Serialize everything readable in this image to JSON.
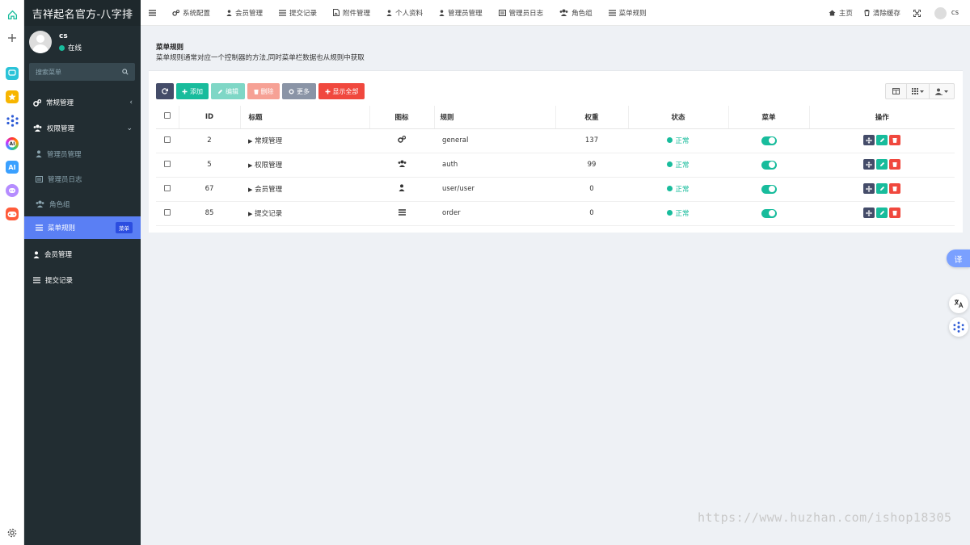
{
  "app_strip": {
    "icons": [
      "home-icon",
      "plus-icon",
      "chat-app-icon",
      "star-app-icon",
      "network-app-icon",
      "ai-ring-app-icon",
      "ai-app-icon",
      "discord-app-icon",
      "gamepad-app-icon"
    ],
    "settings_icon": "gear-icon"
  },
  "sidebar": {
    "logo": "吉祥起名官方-八字排",
    "user": {
      "name": "cs",
      "status": "在线"
    },
    "search_placeholder": "搜索菜单",
    "items": [
      {
        "label": "常规管理",
        "level": "top",
        "icon": "cogs-icon",
        "chevron": "‹"
      },
      {
        "label": "权限管理",
        "level": "top",
        "icon": "users-icon",
        "chevron": "⌄"
      },
      {
        "label": "管理员管理",
        "level": "sub",
        "icon": "user-icon"
      },
      {
        "label": "管理员日志",
        "level": "sub",
        "icon": "list-alt-icon"
      },
      {
        "label": "角色组",
        "level": "sub",
        "icon": "group-icon"
      },
      {
        "label": "菜单规则",
        "level": "sub",
        "icon": "bars-icon",
        "active": true,
        "badge": "菜单"
      },
      {
        "label": "会员管理",
        "level": "top",
        "icon": "user-icon"
      },
      {
        "label": "提交记录",
        "level": "top",
        "icon": "list-icon"
      }
    ]
  },
  "topbar": {
    "nav": [
      {
        "label": "系统配置",
        "icon": "cogs-icon"
      },
      {
        "label": "会员管理",
        "icon": "user-icon"
      },
      {
        "label": "提交记录",
        "icon": "list-icon"
      },
      {
        "label": "附件管理",
        "icon": "file-image-icon"
      },
      {
        "label": "个人资料",
        "icon": "user-icon"
      },
      {
        "label": "管理员管理",
        "icon": "user-icon"
      },
      {
        "label": "管理员日志",
        "icon": "list-alt-icon"
      },
      {
        "label": "角色组",
        "icon": "group-icon"
      },
      {
        "label": "菜单规则",
        "icon": "bars-icon"
      }
    ],
    "right": {
      "home": "主页",
      "clear_cache": "清除缓存",
      "user": "cs"
    }
  },
  "page": {
    "title": "菜单规则",
    "description": "菜单规则通常对应一个控制器的方法,同时菜单栏数据也从规则中获取"
  },
  "toolbar": {
    "add": "添加",
    "edit": "编辑",
    "delete": "删除",
    "more": "更多",
    "show_all": "显示全部"
  },
  "table": {
    "columns": [
      "ID",
      "标题",
      "图标",
      "规则",
      "权重",
      "状态",
      "菜单",
      "操作"
    ],
    "rows": [
      {
        "id": "2",
        "title": "常规管理",
        "icon": "cogs-icon",
        "rule": "general",
        "weight": "137",
        "status": "正常",
        "menu": true
      },
      {
        "id": "5",
        "title": "权限管理",
        "icon": "users-icon",
        "rule": "auth",
        "weight": "99",
        "status": "正常",
        "menu": true
      },
      {
        "id": "67",
        "title": "会员管理",
        "icon": "user-icon",
        "rule": "user/user",
        "weight": "0",
        "status": "正常",
        "menu": true
      },
      {
        "id": "85",
        "title": "提交记录",
        "icon": "list-icon",
        "rule": "order",
        "weight": "0",
        "status": "正常",
        "menu": true
      }
    ]
  },
  "floating": {
    "translate": "译"
  },
  "watermark": "https://www.huzhan.com/ishop18305",
  "colors": {
    "sidebar": "#222d32",
    "active": "#5a7ff4",
    "success": "#18bc9c",
    "danger": "#f0483e",
    "dark_btn": "#444c69"
  }
}
